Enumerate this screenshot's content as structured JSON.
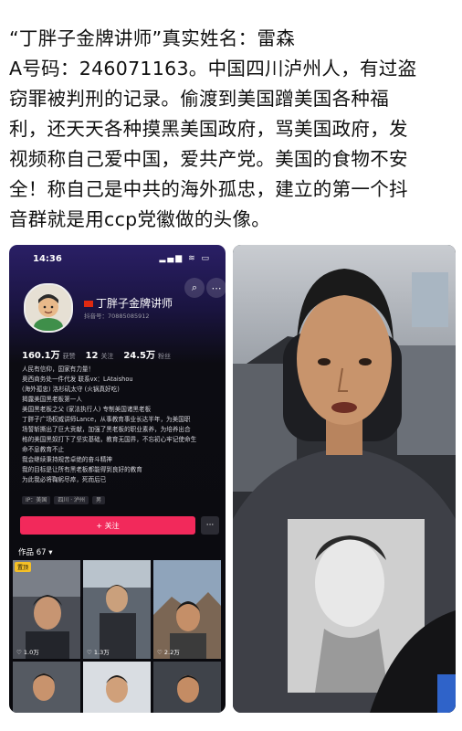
{
  "post": {
    "lines": [
      "“丁胖子金牌讲师”真实姓名：雷森",
      "A号码：246071163。中国四川泸州人，有过盗",
      "窃罪被判刑的记录。偷渡到美国蹭美国各种福",
      "利，还天天各种摸黑美国政府，骂美国政府，发",
      "视频称自己爱中国，爱共产党。美国的食物不安",
      "全！称自己是中共的海外孤忠，建立的第一个抖",
      "音群就是用ccp党徽做的头像。"
    ]
  },
  "phone": {
    "time": "14:36",
    "status_icons": "▂▄▆ ≋ ▭",
    "profile": {
      "name": "丁胖子金牌讲师",
      "id": "抖音号：70885085912",
      "stats": [
        {
          "value": "160.1万",
          "label": "获赞"
        },
        {
          "value": "12",
          "label": "关注"
        },
        {
          "value": "24.5万",
          "label": "粉丝"
        }
      ],
      "bio": [
        "人民有信仰，国家有力量！",
        "奥西商务处一件代发 联系vx：LAtaishou",
        "(海外孤忠) 洛杉矶太守 (火锅真好吃)",
        "揭露美国黑老板第一人",
        "美国黑老板之父 (家法执行人) 专制美国诸黑老板",
        "丁胖子广场权威讲师Lance，从事教育事业长达半年，为美国职",
        "场誓斩撕出了巨大贡献，加强了黑老板的职业素养，为培养出合",
        "格的美国黑奴打下了坚实基础，教育无国界，不忘初心牢记使命生",
        "命不息教育不止",
        "我会继续秉持规苦卓绝的奋斗精神",
        "我的目标是让所有黑老板都能得到良好的教育",
        "为此我必将鞠躬尽瘁，死而后已"
      ],
      "tags": [
        "IP：美国",
        "四川 · 泸州",
        "男"
      ],
      "follow_label": "+ 关注",
      "more_label": "···"
    },
    "works": {
      "label": "作品 67 ▾",
      "pin_label": "置顶",
      "items": [
        {
          "count": "♡ 1.0万"
        },
        {
          "count": "♡ 1.3万"
        },
        {
          "count": "♡ 2.2万"
        },
        {
          "count": ""
        },
        {
          "count": ""
        },
        {
          "count": ""
        }
      ]
    }
  },
  "colors": {
    "follow_button": "#f2295b",
    "phone_bg": "#0a0a0e",
    "header_gradient": "#2a1f66"
  }
}
